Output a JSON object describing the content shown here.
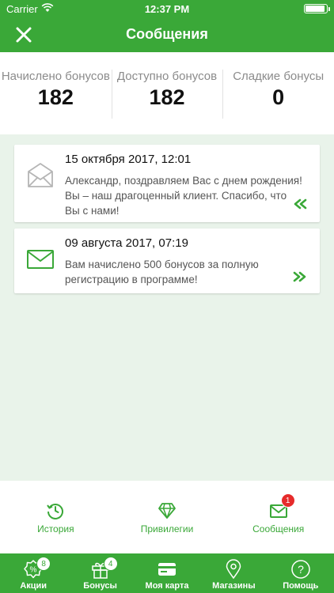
{
  "status_bar": {
    "carrier": "Carrier",
    "time": "12:37 PM"
  },
  "header": {
    "title": "Сообщения",
    "close_icon": "close-icon"
  },
  "stats": [
    {
      "label": "Начислено бонусов",
      "value": "182"
    },
    {
      "label": "Доступно бонусов",
      "value": "182"
    },
    {
      "label": "Сладкие бонусы",
      "value": "0"
    }
  ],
  "messages": [
    {
      "date": "15 октября 2017, 12:01",
      "text": "Александр, поздравляем Вас с днем рождения! Вы – наш драгоценный клиент. Спасибо, что Вы с нами!",
      "read": true
    },
    {
      "date": "09 августа 2017, 07:19",
      "text": "Вам начислено 500 бонусов за полную регистрацию в программе!",
      "read": false
    }
  ],
  "subnav": [
    {
      "label": "История",
      "icon": "history-icon"
    },
    {
      "label": "Привилегии",
      "icon": "diamond-icon"
    },
    {
      "label": "Сообщения",
      "icon": "mail-icon",
      "badge": "1"
    }
  ],
  "tabbar": [
    {
      "label": "Акции",
      "icon": "discount-badge-icon",
      "badge": "8"
    },
    {
      "label": "Бонусы",
      "icon": "gift-icon",
      "badge": "4"
    },
    {
      "label": "Моя карта",
      "icon": "card-icon"
    },
    {
      "label": "Магазины",
      "icon": "map-pin-icon"
    },
    {
      "label": "Помощь",
      "icon": "help-icon"
    }
  ],
  "colors": {
    "primary": "#3aa838",
    "background": "#e9f3ea",
    "badge": "#e62b2b"
  }
}
